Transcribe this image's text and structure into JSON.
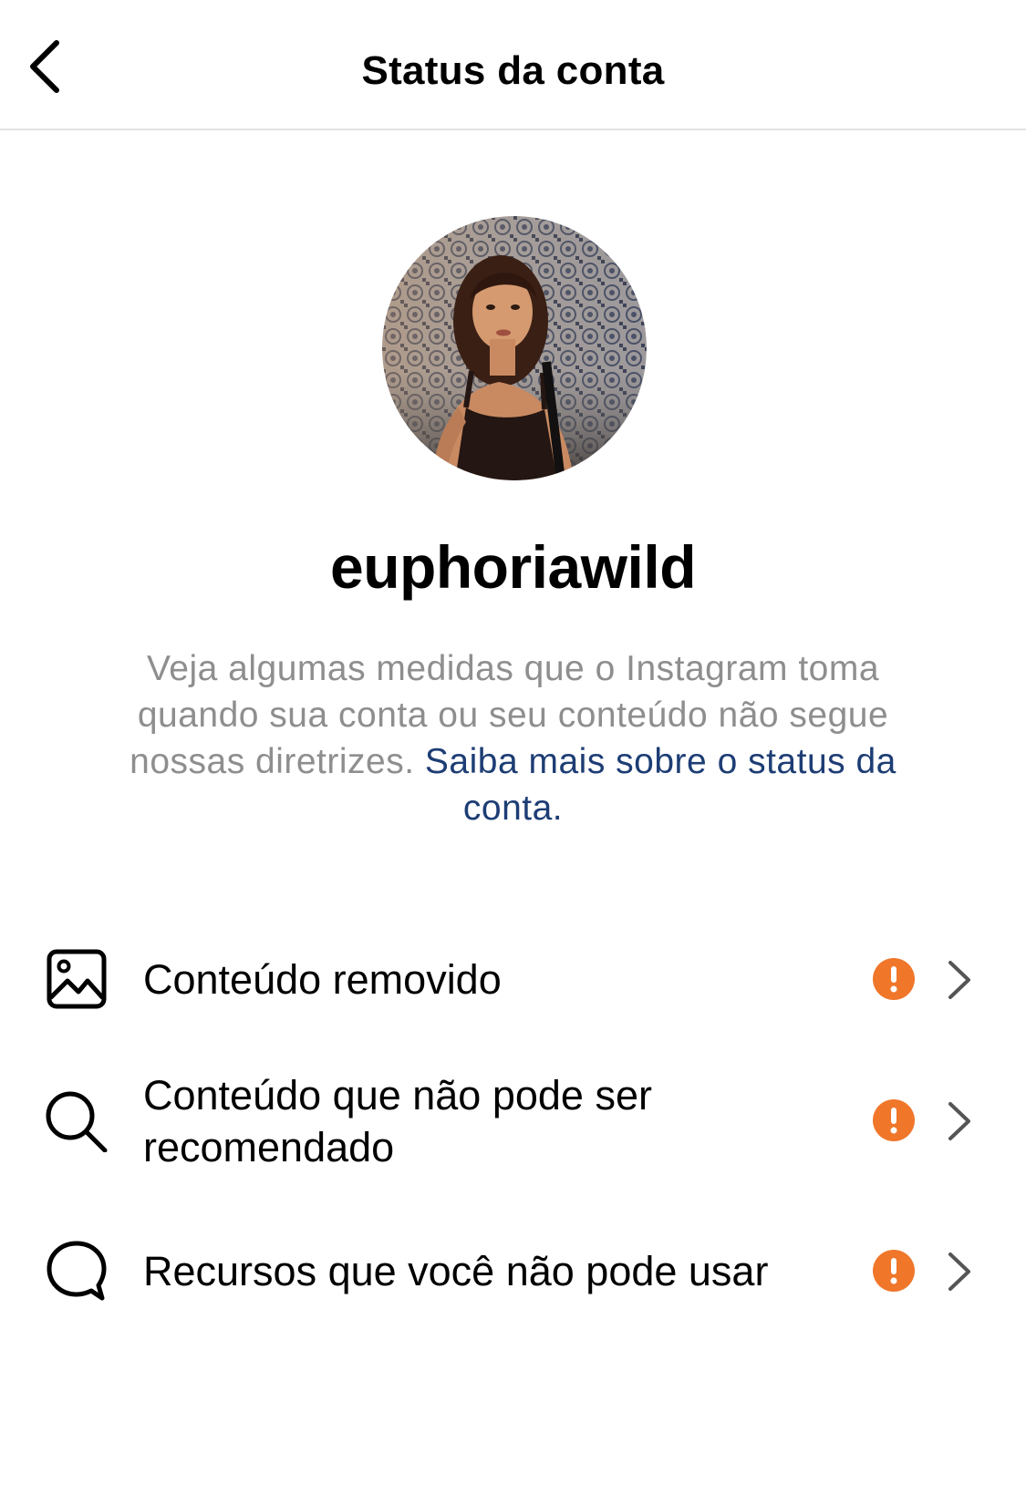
{
  "header": {
    "title": "Status da conta",
    "back_icon": "chevron-left-icon"
  },
  "profile": {
    "username": "euphoriawild",
    "avatar_icon": "profile-photo"
  },
  "description": {
    "text": "Veja algumas medidas que o Instagram toma quando sua conta ou seu conteúdo não segue nossas diretrizes. ",
    "link_text": "Saiba mais sobre o status da conta."
  },
  "items": [
    {
      "label": "Conteúdo removido",
      "icon": "image-icon",
      "status_icon": "warning-icon",
      "arrow_icon": "chevron-right-icon"
    },
    {
      "label": "Conteúdo que não pode ser recomendado",
      "icon": "search-icon",
      "status_icon": "warning-icon",
      "arrow_icon": "chevron-right-icon"
    },
    {
      "label": "Recursos que você não pode usar",
      "icon": "comment-icon",
      "status_icon": "warning-icon",
      "arrow_icon": "chevron-right-icon"
    }
  ],
  "colors": {
    "warning": "#f0762a",
    "link": "#1d3d74",
    "secondary_text": "#8e8e8e",
    "divider": "#e3e3e3"
  }
}
